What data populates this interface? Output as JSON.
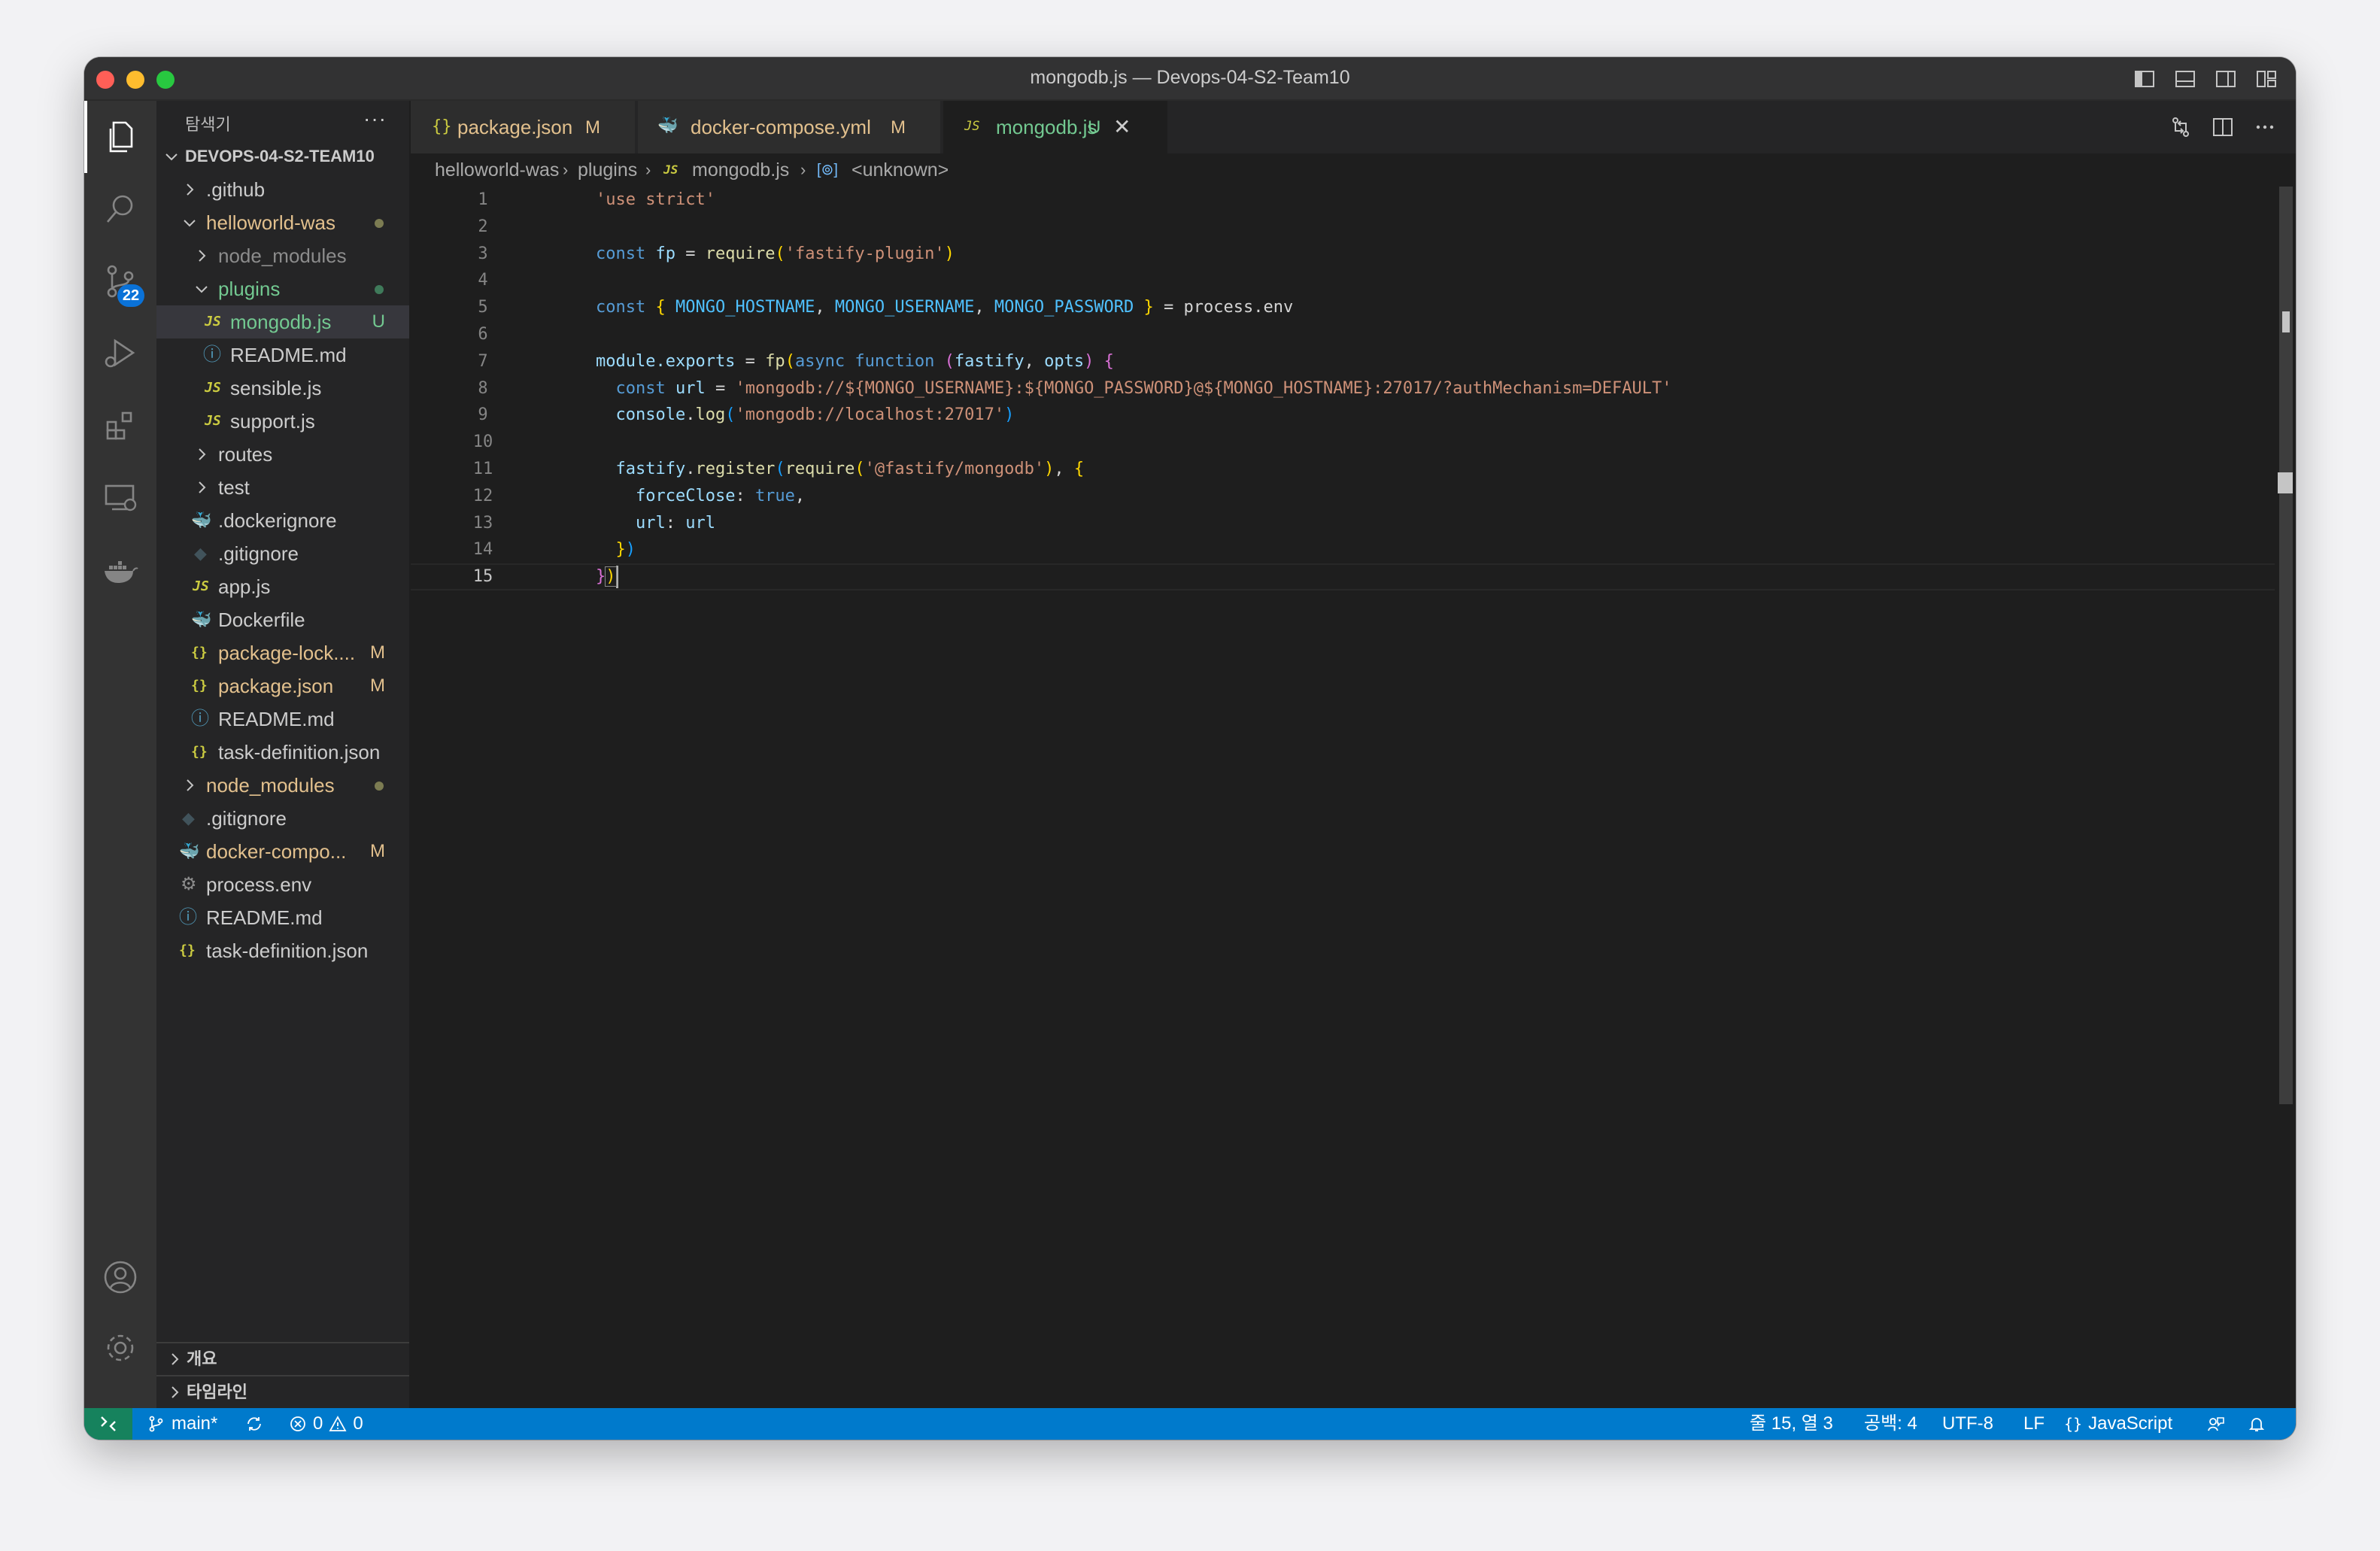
{
  "window": {
    "title": "mongodb.js — Devops-04-S2-Team10"
  },
  "activity": {
    "scm_badge": "22"
  },
  "sidebar": {
    "title": "탐색기",
    "more": "···",
    "root": "DEVOPS-04-S2-TEAM10",
    "items": [
      {
        "label": "README.md"
      }
    ],
    "tree": {
      "github": ".github",
      "helloworld_was": "helloworld-was",
      "node_modules_inner": "node_modules",
      "plugins": "plugins",
      "mongodb_js": "mongodb.js",
      "mongodb_js_status": "U",
      "readme_inner": "README.md",
      "sensible_js": "sensible.js",
      "support_js": "support.js",
      "routes": "routes",
      "test": "test",
      "dockerignore": ".dockerignore",
      "gitignore_inner": ".gitignore",
      "app_js": "app.js",
      "dockerfile": "Dockerfile",
      "package_lock": "package-lock....",
      "package_lock_status": "M",
      "package_json": "package.json",
      "package_json_status": "M",
      "readme_was": "README.md",
      "task_def_was": "task-definition.json",
      "node_modules_root": "node_modules",
      "gitignore_root": ".gitignore",
      "docker_compose": "docker-compo...",
      "docker_compose_status": "M",
      "process_env": "process.env",
      "readme_root": "README.md",
      "task_def_root": "task-definition.json"
    },
    "panels": {
      "outline": "개요",
      "timeline": "타임라인"
    }
  },
  "tabs": [
    {
      "label": "package.json",
      "status": "M"
    },
    {
      "label": "docker-compose.yml",
      "status": "M"
    },
    {
      "label": "mongodb.js",
      "status": "U"
    }
  ],
  "breadcrumb": {
    "folder": "helloworld-was",
    "subfolder": "plugins",
    "file": "mongodb.js",
    "symbol": "<unknown>"
  },
  "code": {
    "line_numbers": [
      "1",
      "2",
      "3",
      "4",
      "5",
      "6",
      "7",
      "8",
      "9",
      "10",
      "11",
      "12",
      "13",
      "14",
      "15"
    ],
    "l1": "'use strict'",
    "l3_kw": "const",
    "l3_var": "fp",
    "l3_eq": " = ",
    "l3_fn": "require",
    "l3_str": "'fastify-plugin'",
    "l5_kw": "const",
    "l5_c1": "MONGO_HOSTNAME",
    "l5_c2": "MONGO_USERNAME",
    "l5_c3": "MONGO_PASSWORD",
    "l5_rhs": " = process.env",
    "l7_a": "module.exports",
    "l7_eq": " = ",
    "l7_fn": "fp",
    "l7_kw1": "async",
    "l7_kw2": "function",
    "l7_p1": "fastify",
    "l7_p2": "opts",
    "l8_kw": "const",
    "l8_var": "url",
    "l8_str": "'mongodb://${MONGO_USERNAME}:${MONGO_PASSWORD}@${MONGO_HOSTNAME}:27017/?authMechanism=DEFAULT'",
    "l9_obj": "console",
    "l9_fn": "log",
    "l9_str": "'mongodb://localhost:27017'",
    "l11_obj": "fastify",
    "l11_fn": "register",
    "l11_fn2": "require",
    "l11_str": "'@fastify/mongodb'",
    "l12_key": "forceClose",
    "l12_val": "true",
    "l13_key": "url",
    "l13_val": "url"
  },
  "status": {
    "branch": "main*",
    "errors": "0",
    "warnings": "0",
    "position": "줄 15, 열 3",
    "spaces": "공백: 4",
    "encoding": "UTF-8",
    "eol": "LF",
    "language": "JavaScript"
  }
}
